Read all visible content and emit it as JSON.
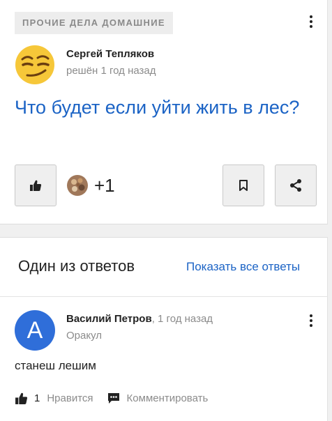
{
  "question": {
    "category": "ПРОЧИЕ ДЕЛА ДОМАШНИЕ",
    "author": "Сергей Тепляков",
    "meta": "решён 1 год назад",
    "title": "Что будет если уйти жить в лес?",
    "likes": "+1"
  },
  "answers": {
    "section_title": "Один из ответов",
    "show_all": "Показать все ответы",
    "item": {
      "avatar_letter": "A",
      "author": "Василий Петров",
      "time": ", 1 год назад",
      "role": "Оракул",
      "text": "станеш лешим",
      "like_count": "1",
      "like_label": "Нравится",
      "comment_label": "Комментировать"
    }
  },
  "colors": {
    "link": "#1b63c5",
    "avatar_bg": "#2f6ed9",
    "muted": "#8b8b8b"
  },
  "icons": [
    "more-vertical-icon",
    "thumbs-up-icon",
    "bookmark-icon",
    "share-icon",
    "comment-icon"
  ]
}
